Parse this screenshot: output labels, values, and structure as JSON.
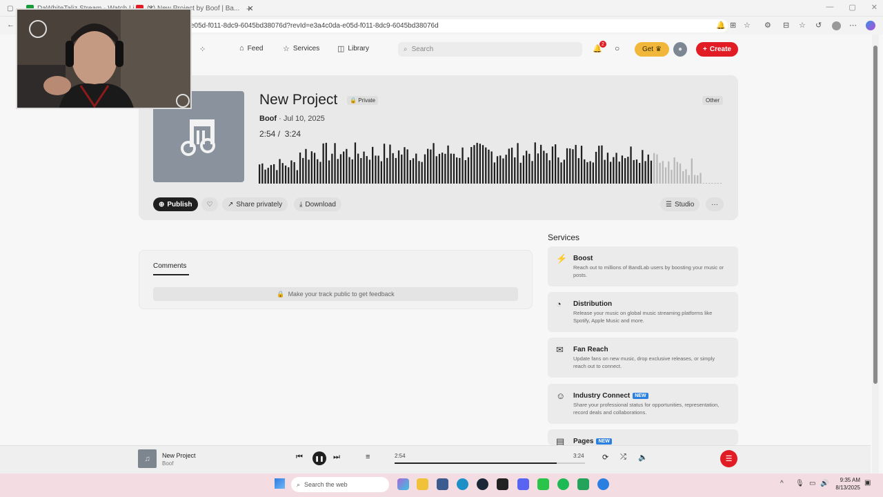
{
  "browser": {
    "tabs": [
      {
        "title": "DaWhiteTaliz Stream - Watch Li...",
        "color": "#1a9b3a"
      },
      {
        "title": "(1) New Project by Boof | Ba...",
        "color": "#e21c25"
      }
    ],
    "new_tab_label": "+",
    "url": "e05d-f011-8dc9-6045bd38076d?revId=e3a4c0da-e05d-f011-8dc9-6045bd38076d"
  },
  "header": {
    "nav": [
      {
        "label": "Feed",
        "icon": "home-icon"
      },
      {
        "label": "Services",
        "icon": "star-icon"
      },
      {
        "label": "Library",
        "icon": "library-icon"
      }
    ],
    "search_placeholder": "Search",
    "notification_count": "2",
    "get_label": "Get",
    "create_label": "Create"
  },
  "track": {
    "title": "New Project",
    "privacy": "Private",
    "category": "Other",
    "artist": "Boof",
    "date": "Jul 10, 2025",
    "time_elapsed": "2:54",
    "time_total": "3:24",
    "progress": 0.853
  },
  "actions": {
    "publish": "Publish",
    "share": "Share privately",
    "download": "Download",
    "studio": "Studio",
    "more": "···"
  },
  "comments": {
    "title": "Comments",
    "note": "Make your track public to get feedback"
  },
  "services": {
    "title": "Services",
    "items": [
      {
        "name": "Boost",
        "desc": "Reach out to millions of BandLab users by boosting your music or posts.",
        "icon": "bolt-icon",
        "new": ""
      },
      {
        "name": "Distribution",
        "desc": "Release your music on global music streaming platforms like Spotify, Apple Music and more.",
        "icon": "globe-icon",
        "new": ""
      },
      {
        "name": "Fan Reach",
        "desc": "Update fans on new music, drop exclusive releases, or simply reach out to connect.",
        "icon": "mail-icon",
        "new": ""
      },
      {
        "name": "Industry Connect",
        "desc": "Share your professional status for opportunities, representation, record deals and collaborations.",
        "icon": "people-icon",
        "new": "NEW"
      },
      {
        "name": "Pages",
        "desc": "",
        "icon": "pages-icon",
        "new": "NEW"
      }
    ]
  },
  "player": {
    "title": "New Project",
    "artist": "Boof",
    "time_elapsed": "2:54",
    "time_total": "3:24"
  },
  "taskbar": {
    "search_placeholder": "Search the web",
    "time": "9:35 AM",
    "date": "8/13/2025"
  },
  "colors": {
    "accent": "#e21c25",
    "get": "#f0b73b",
    "new_badge": "#2a7fe0"
  }
}
